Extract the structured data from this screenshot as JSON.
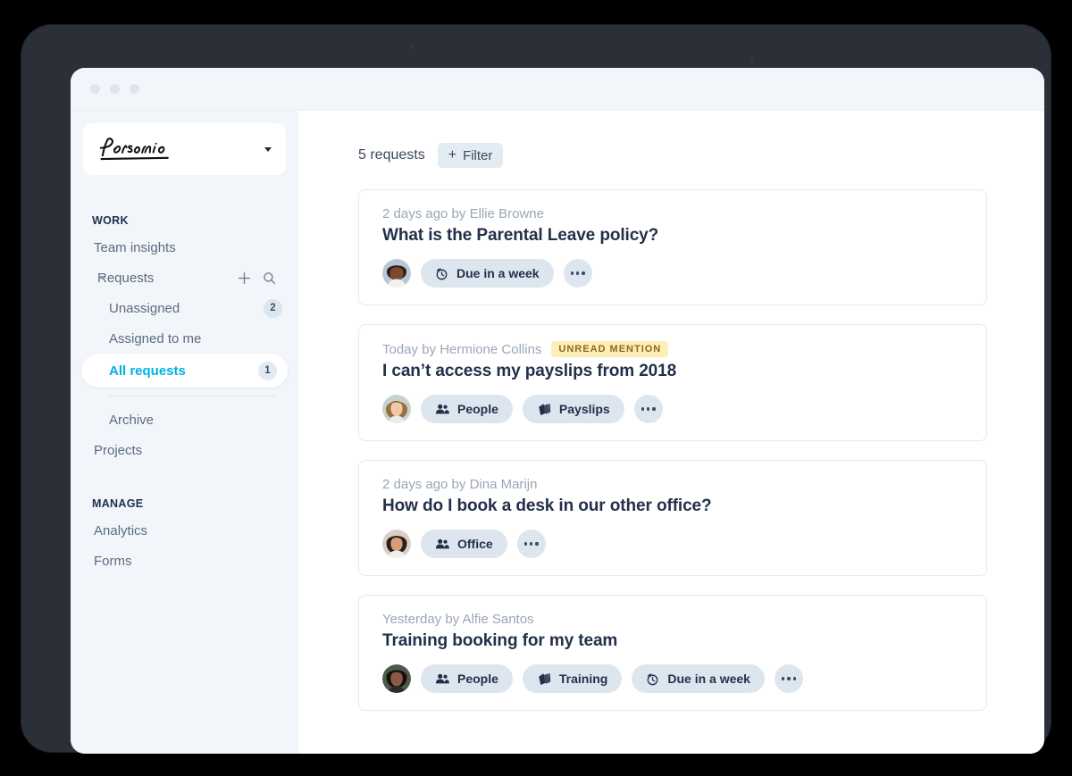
{
  "window": {
    "traffic_lights": [
      "dot-1",
      "dot-2",
      "dot-3"
    ]
  },
  "sidebar": {
    "brand": {
      "name": "Personio",
      "caret_icon": "chevron-down-icon"
    },
    "sections": [
      {
        "label": "WORK",
        "items": [
          {
            "label": "Team insights",
            "type": "item"
          },
          {
            "label": "Requests",
            "type": "group",
            "caret_icon": "caret-down-icon",
            "add_icon": "plus-icon",
            "search_icon": "search-icon"
          },
          {
            "label": "Unassigned",
            "type": "sub",
            "count": "2"
          },
          {
            "label": "Assigned to me",
            "type": "sub"
          },
          {
            "label": "All requests",
            "type": "sub",
            "count": "1",
            "active": true
          },
          {
            "label": "Archive",
            "type": "sub"
          },
          {
            "label": "Projects",
            "type": "item"
          }
        ]
      },
      {
        "label": "MANAGE",
        "items": [
          {
            "label": "Analytics",
            "type": "item"
          },
          {
            "label": "Forms",
            "type": "item"
          }
        ]
      }
    ]
  },
  "main": {
    "header": {
      "count_label": "5 requests",
      "filter_label": "Filter",
      "filter_plus": "+"
    },
    "requests": [
      {
        "meta": "2 days ago by Ellie Browne",
        "badge": null,
        "title": "What is the Parental Leave policy?",
        "avatar": "avatar-ellie-browne",
        "chips": [
          {
            "label": "Due in a week",
            "icon": "stopwatch-icon"
          }
        ],
        "more_label": "more-options"
      },
      {
        "meta": "Today by Hermione Collins",
        "badge": "UNREAD MENTION",
        "title": "I can’t access my payslips from 2018",
        "avatar": "avatar-hermione-collins",
        "chips": [
          {
            "label": "People",
            "icon": "people-icon"
          },
          {
            "label": "Payslips",
            "icon": "documents-icon"
          }
        ],
        "more_label": "more-options"
      },
      {
        "meta": "2 days ago by Dina Marijn",
        "badge": null,
        "title": "How do I book a desk in our other office?",
        "avatar": "avatar-dina-marijn",
        "chips": [
          {
            "label": "Office",
            "icon": "people-icon"
          }
        ],
        "more_label": "more-options"
      },
      {
        "meta": "Yesterday by Alfie Santos",
        "badge": null,
        "title": "Training booking for my team",
        "avatar": "avatar-alfie-santos",
        "chips": [
          {
            "label": "People",
            "icon": "people-icon"
          },
          {
            "label": "Training",
            "icon": "documents-icon"
          },
          {
            "label": "Due in a week",
            "icon": "stopwatch-icon"
          }
        ],
        "more_label": "more-options"
      }
    ]
  },
  "colors": {
    "accent": "#00b2e3",
    "sidebar_bg": "#f2f6fa",
    "title_text": "#23304a",
    "muted_text": "#9aa6b5",
    "chip_bg": "#dde6ef",
    "badge_bg": "#fdeeb8",
    "badge_text": "#8a6c18"
  }
}
